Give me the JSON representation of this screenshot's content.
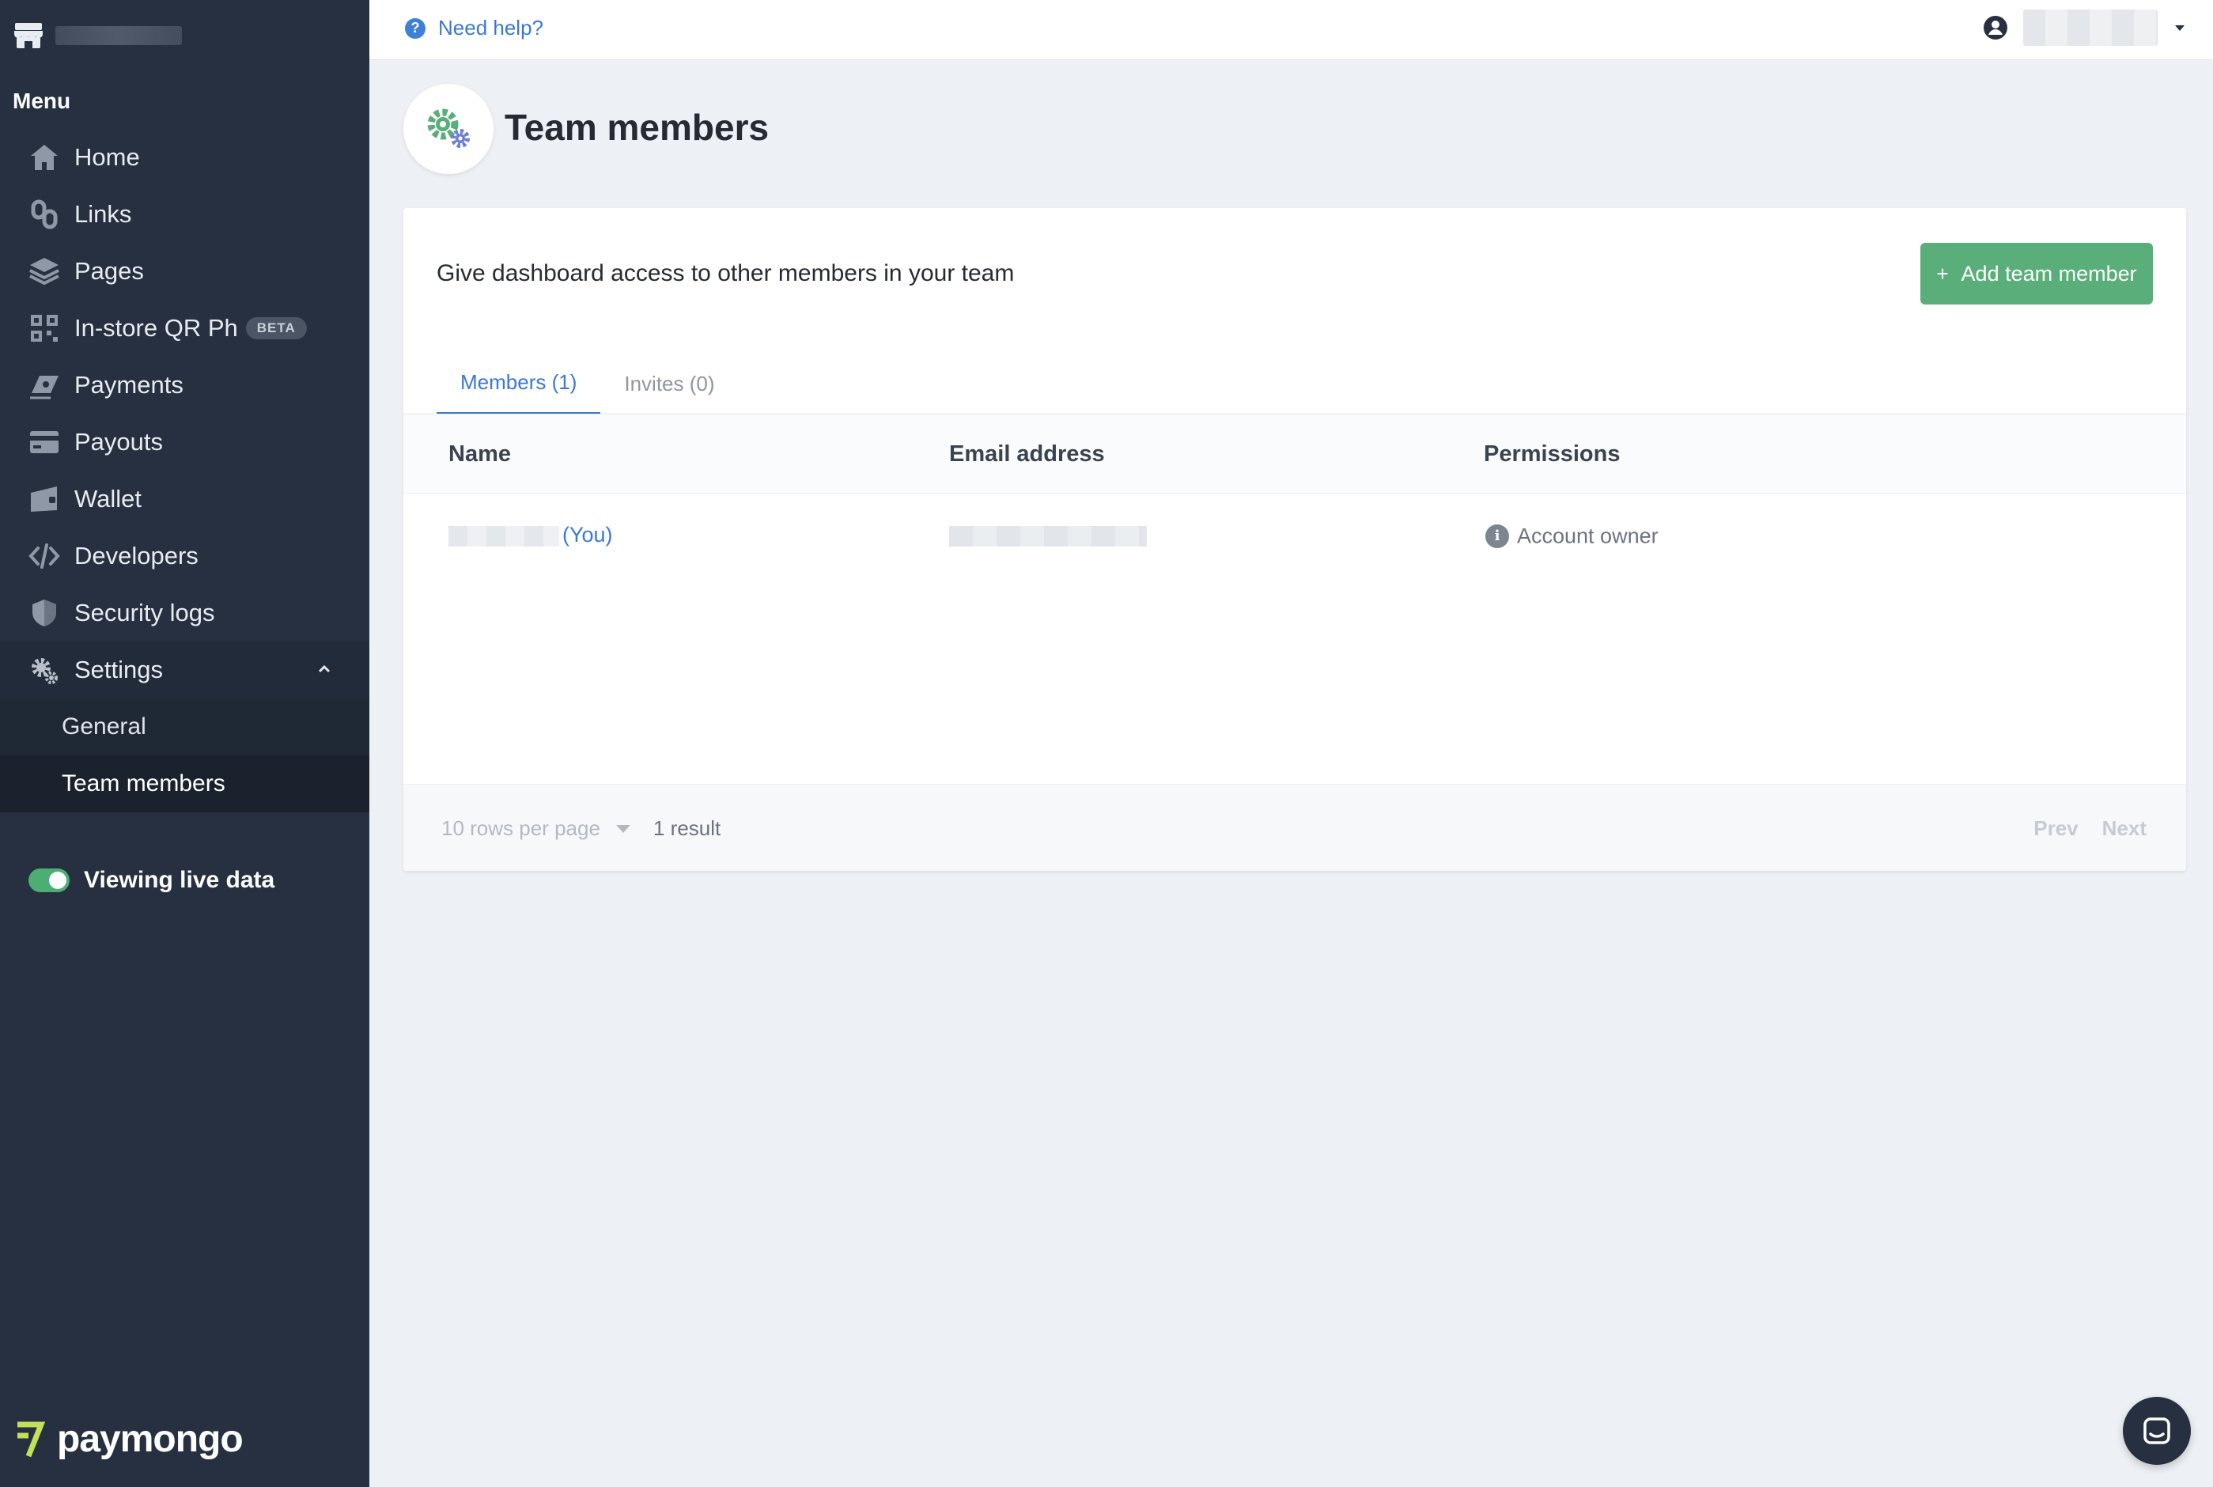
{
  "sidebar": {
    "menu_heading": "Menu",
    "items": [
      {
        "label": "Home",
        "icon": "home-icon"
      },
      {
        "label": "Links",
        "icon": "links-icon"
      },
      {
        "label": "Pages",
        "icon": "pages-icon"
      },
      {
        "label": "In-store QR Ph",
        "icon": "qr-icon",
        "badge": "BETA"
      },
      {
        "label": "Payments",
        "icon": "payments-icon"
      },
      {
        "label": "Payouts",
        "icon": "payouts-icon"
      },
      {
        "label": "Wallet",
        "icon": "wallet-icon"
      },
      {
        "label": "Developers",
        "icon": "code-icon"
      },
      {
        "label": "Security logs",
        "icon": "shield-icon"
      },
      {
        "label": "Settings",
        "icon": "gear-icon",
        "expanded": true
      }
    ],
    "sub_items": [
      {
        "label": "General"
      },
      {
        "label": "Team members",
        "active": true
      }
    ],
    "live_toggle_label": "Viewing live data",
    "brand_logo_text": "paymongo"
  },
  "topbar": {
    "help_text": "Need help?"
  },
  "page": {
    "title": "Team members"
  },
  "card": {
    "intro": "Give dashboard access to other members in your team",
    "add_button": "Add team member",
    "tabs": [
      {
        "label": "Members (1)",
        "active": true
      },
      {
        "label": "Invites (0)",
        "active": false
      }
    ],
    "columns": [
      "Name",
      "Email address",
      "Permissions"
    ],
    "rows": [
      {
        "name_suffix": "(You)",
        "permission": "Account owner"
      }
    ],
    "footer": {
      "rows_per_page": "10 rows per page",
      "result_count": "1 result",
      "prev": "Prev",
      "next": "Next"
    }
  },
  "colors": {
    "sidebar_bg": "#263040",
    "accent_green": "#5aae7a",
    "link_blue": "#3b78d0"
  }
}
